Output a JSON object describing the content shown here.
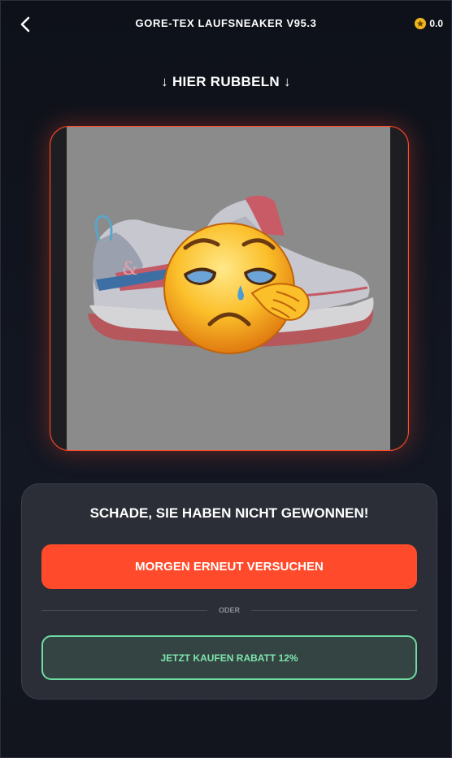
{
  "header": {
    "title": "GORE-TEX LAUFSNEAKER V95.3",
    "coins": "0.0",
    "back_icon": "chevron-left-icon",
    "coin_icon": "star-coin-icon"
  },
  "instruction": "↓ HIER RUBBELN ↓",
  "scratch_card": {
    "image": "running-sneaker",
    "overlay_icon": "crying-face-emoji"
  },
  "result": {
    "title": "SCHADE, SIE HABEN NICHT GEWONNEN!",
    "retry_label": "MORGEN ERNEUT VERSUCHEN",
    "divider_label": "ODER",
    "buy_label": "JETZT KAUFEN RABATT 12%"
  },
  "colors": {
    "accent": "#ff4b2b",
    "success": "#6fdca3",
    "background": "#0f121b",
    "panel": "#2b2e37"
  }
}
